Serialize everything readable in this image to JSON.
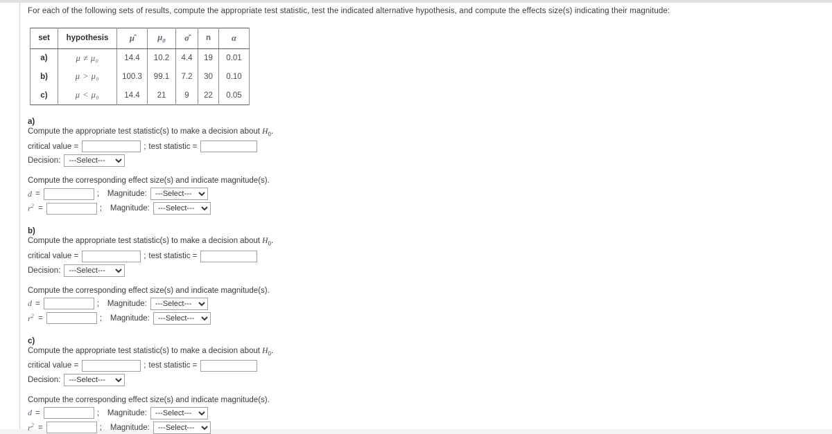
{
  "prompt": "For each of the following sets of results, compute the appropriate test statistic, test the indicated alternative hypothesis, and compute the effects size(s) indicating their magnitude:",
  "table": {
    "headers": [
      "set",
      "hypothesis",
      "μ̂",
      "μ₀",
      "σ̂",
      "n",
      "α"
    ],
    "rows": [
      {
        "set": "a)",
        "hypothesis": "μ ≠ μ₀",
        "mu_hat": "14.4",
        "mu_0": "10.2",
        "sigma_hat": "4.4",
        "n": "19",
        "alpha": "0.01"
      },
      {
        "set": "b)",
        "hypothesis": "μ > μ₀",
        "mu_hat": "100.3",
        "mu_0": "99.1",
        "sigma_hat": "7.2",
        "n": "30",
        "alpha": "0.10"
      },
      {
        "set": "c)",
        "hypothesis": "μ < μ₀",
        "mu_hat": "14.4",
        "mu_0": "21",
        "sigma_hat": "9",
        "n": "22",
        "alpha": "0.05"
      }
    ]
  },
  "labels": {
    "test_statistic_instruction": "Compute the appropriate test statistic(s) to make a decision about H₀.",
    "critical_value": "critical value =",
    "semicolon": ";",
    "test_statistic": "test statistic =",
    "decision": "Decision:",
    "effect_size_instruction": "Compute the corresponding effect size(s) and indicate magnitude(s).",
    "d_label": "d",
    "r2_label": "r²",
    "equals": "=",
    "magnitude": "Magnitude:"
  },
  "select_placeholder": "---Select---",
  "select_options": [
    "---Select---"
  ],
  "fields": {
    "critical_value_placeholder": "",
    "test_statistic_placeholder": "",
    "d_placeholder": "",
    "r2_placeholder": ""
  },
  "sections": [
    {
      "id": "a",
      "label": "a)",
      "critical_value": "",
      "test_statistic": "",
      "decision": "---Select---",
      "d": "",
      "d_magnitude": "---Select---",
      "r2": "",
      "r2_magnitude": "---Select---"
    },
    {
      "id": "b",
      "label": "b)",
      "critical_value": "",
      "test_statistic": "",
      "decision": "---Select---",
      "d": "",
      "d_magnitude": "---Select---",
      "r2": "",
      "r2_magnitude": "---Select---"
    },
    {
      "id": "c",
      "label": "c)",
      "critical_value": "",
      "test_statistic": "",
      "decision": "---Select---",
      "d": "",
      "d_magnitude": "---Select---",
      "r2": "",
      "r2_magnitude": "---Select---"
    }
  ],
  "colors": {
    "text": "#3b3b3b",
    "symbol": "#5a6570",
    "border": "#8c8c8c",
    "table_outer_border": "#5a5a5a",
    "input_border": "#a0a0a0",
    "page_background": "#ffffff"
  }
}
